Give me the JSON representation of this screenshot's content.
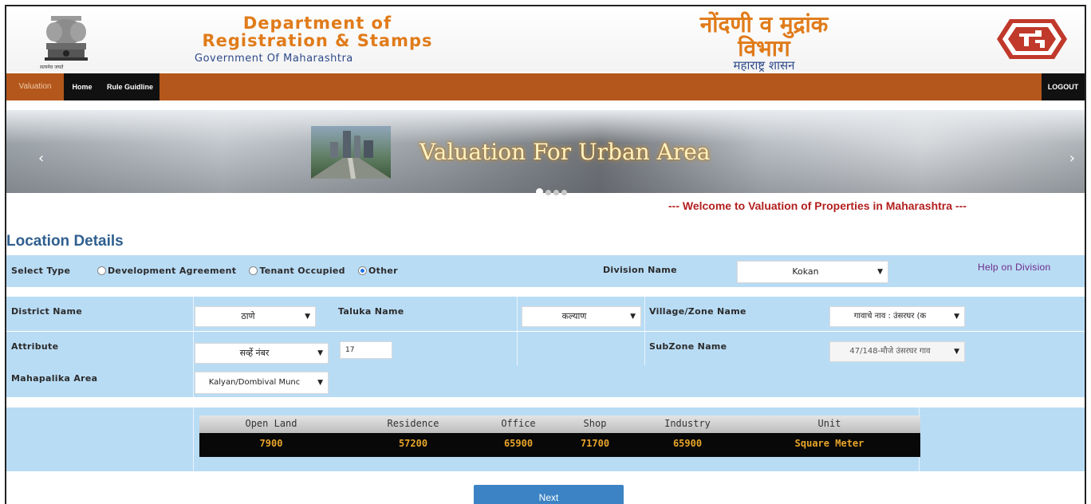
{
  "header": {
    "dept_title_line1": "Department of",
    "dept_title_line2": "Registration & Stamps",
    "dept_subtitle": "Government Of Maharashtra",
    "mr_title_line1": "नोंदणी व मुद्रांक",
    "mr_title_line2": "विभाग",
    "mr_subtitle": "महाराष्ट्र शासन",
    "emblem_caption": "सत्यमेव जयते"
  },
  "nav": {
    "valuation": "Valuation",
    "home": "Home",
    "rule_guideline": "Rule Guidline",
    "logout": "LOGOUT"
  },
  "banner": {
    "title": "Valuation For Urban Area",
    "prev_icon": "chevron-left-icon",
    "next_icon": "chevron-right-icon",
    "slide_count": 4,
    "active_slide": 1
  },
  "welcome_text": "--- Welcome to Valuation of Properties in Maharashtra ---",
  "location_title": "Location Details",
  "select_type": {
    "label": "Select Type",
    "options": [
      "Development Agreement",
      "Tenant Occupied",
      "Other"
    ],
    "selected": "Other"
  },
  "division": {
    "label": "Division Name",
    "value": "Kokan",
    "help_link": "Help on Division"
  },
  "district": {
    "label": "District Name",
    "value": "ठाणे"
  },
  "taluka": {
    "label": "Taluka Name",
    "value": "कल्याण"
  },
  "village": {
    "label": "Village/Zone Name",
    "value": "गावाचे नाव : उंसरघर (क"
  },
  "attribute": {
    "label": "Attribute",
    "value": "सर्व्हे नंबर",
    "input_value": "17"
  },
  "subzone": {
    "label": "SubZone Name",
    "value": "47/148-मौजे उंसरघर गाव"
  },
  "mahapalika": {
    "label": "Mahapalika Area",
    "value": "Kalyan/Dombival Munc"
  },
  "rates_table": {
    "headers": [
      "Open Land",
      "Residence",
      "Office",
      "Shop",
      "Industry",
      "Unit"
    ],
    "values": [
      "7900",
      "57200",
      "65900",
      "71700",
      "65900",
      "Square Meter"
    ]
  },
  "next_button": "Next",
  "colors": {
    "nav_bg": "#b4571c",
    "row_bg": "#b9dcf5",
    "title_orange": "#e07b1a",
    "title_blue": "#2e4a8a",
    "welcome_red": "#b32020",
    "next_btn": "#3b83c4"
  }
}
